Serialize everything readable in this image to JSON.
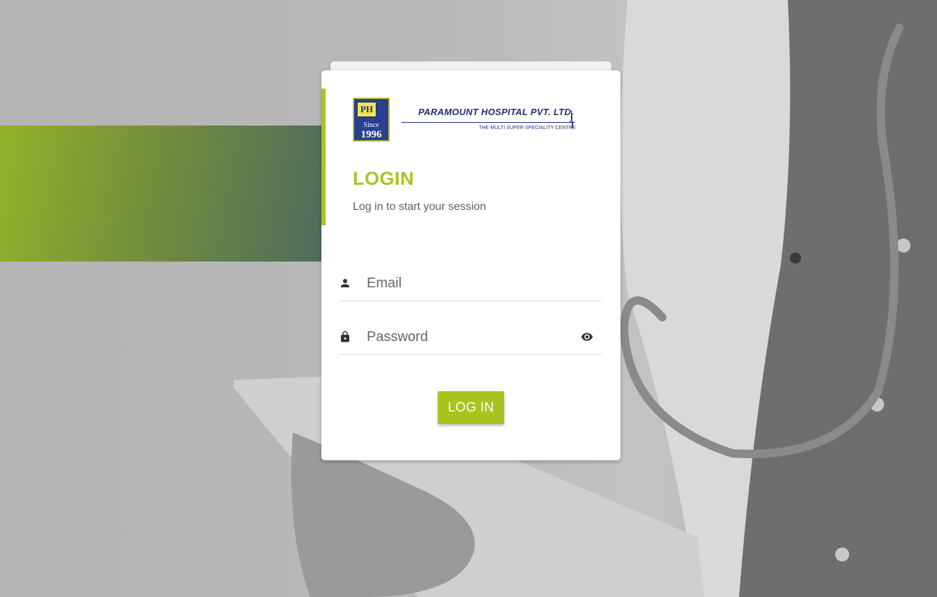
{
  "brand": {
    "badge_letters": "PH",
    "badge_since": "Since",
    "badge_year": "1996",
    "name": "PARAMOUNT HOSPITAL PVT. LTD.",
    "tagline": "THE MULTI SUPER SPECIALITY CENTRE",
    "accent_color": "#a8c41f",
    "logo_color": "#1f2e73"
  },
  "login": {
    "title": "LOGIN",
    "subtitle": "Log in to start your session"
  },
  "form": {
    "email": {
      "placeholder": "Email",
      "value": "",
      "icon": "person-icon"
    },
    "password": {
      "placeholder": "Password",
      "value": "",
      "icon": "lock-icon",
      "toggle_icon": "eye-icon"
    },
    "submit_label": "LOG IN"
  },
  "background": {
    "band_color": "#93b32a"
  }
}
